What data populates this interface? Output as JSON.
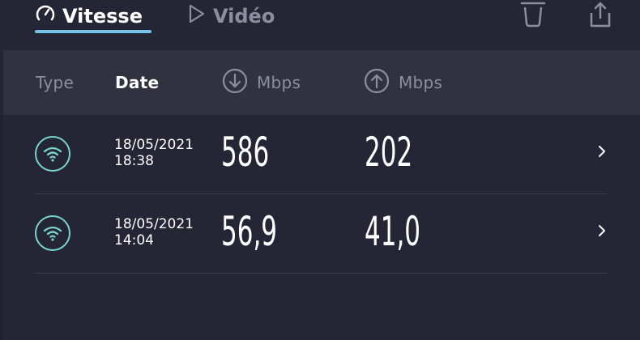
{
  "tabs": {
    "speed": {
      "label": "Vitesse"
    },
    "video": {
      "label": "Vidéo"
    }
  },
  "actions": {
    "trash": "trash-icon",
    "share": "share-icon"
  },
  "header": {
    "type": "Type",
    "date": "Date",
    "download": "Mbps",
    "upload": "Mbps"
  },
  "rows": [
    {
      "date": "18/05/2021",
      "time": "18:38",
      "download": "586",
      "upload": "202",
      "type_icon": "wifi-icon"
    },
    {
      "date": "18/05/2021",
      "time": "14:04",
      "download": "56,9",
      "upload": "41,0",
      "type_icon": "wifi-icon"
    }
  ],
  "colors": {
    "background": "#242636",
    "header": "#30333f",
    "accent": "#74c3e6",
    "wifi": "#7ad3cf"
  }
}
